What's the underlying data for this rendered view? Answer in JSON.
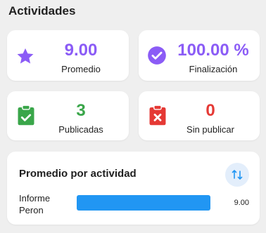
{
  "section_title": "Actividades",
  "colors": {
    "purple": "#8b5cf6",
    "green": "#3aa64a",
    "red": "#e53935",
    "blue": "#2196f3",
    "sort_bg": "#e3eefb"
  },
  "stats": {
    "average": {
      "value": "9.00",
      "label": "Promedio",
      "icon": "star-icon"
    },
    "completion": {
      "value": "100.00 %",
      "label": "Finalización",
      "icon": "check-circle-icon"
    },
    "published": {
      "value": "3",
      "label": "Publicadas",
      "icon": "clipboard-check-icon"
    },
    "unpublished": {
      "value": "0",
      "label": "Sin publicar",
      "icon": "clipboard-x-icon"
    }
  },
  "chart": {
    "title": "Promedio por actividad",
    "sort_icon": "sort-icon",
    "chart_data": {
      "type": "bar",
      "categories": [
        "Informe Peron"
      ],
      "values": [
        9.0
      ],
      "value_labels": [
        "9.00"
      ],
      "xlim": [
        0,
        9
      ]
    }
  }
}
